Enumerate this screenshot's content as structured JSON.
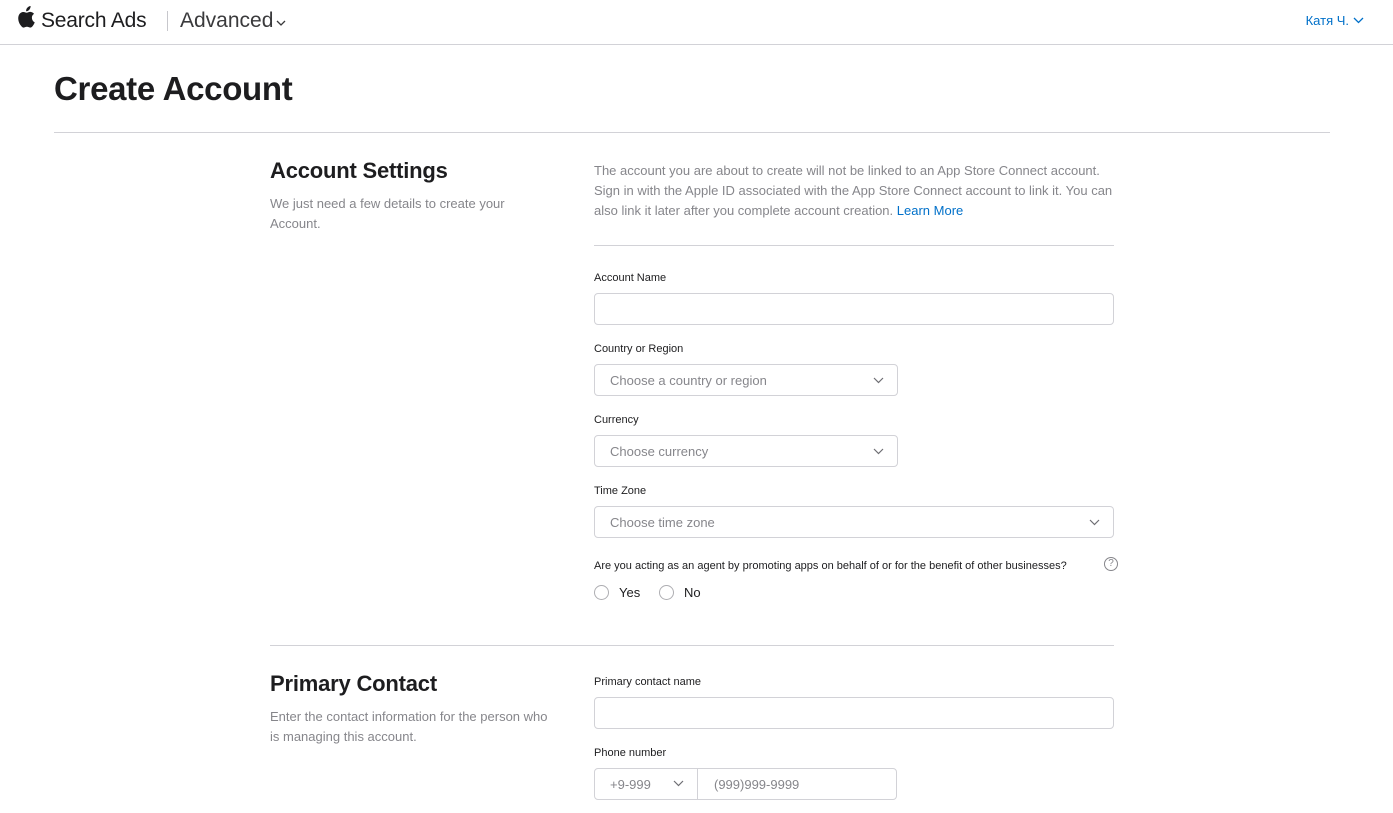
{
  "header": {
    "brand": "Search Ads",
    "mode": "Advanced",
    "user": "Катя Ч."
  },
  "page": {
    "title": "Create Account"
  },
  "account_settings": {
    "title": "Account Settings",
    "description": "We just need a few details to create your Account.",
    "intro_text": "The account you are about to create will not be linked to an App Store Connect account. Sign in with the Apple ID associated with the App Store Connect account to link it. You can also link it later after you complete account creation.",
    "learn_more": "Learn More",
    "account_name_label": "Account Name",
    "account_name_value": "",
    "country_label": "Country or Region",
    "country_placeholder": "Choose a country or region",
    "currency_label": "Currency",
    "currency_placeholder": "Choose currency",
    "timezone_label": "Time Zone",
    "timezone_placeholder": "Choose time zone",
    "agent_question": "Are you acting as an agent by promoting apps on behalf of or for the benefit of other businesses?",
    "help_glyph": "?",
    "yes_label": "Yes",
    "no_label": "No"
  },
  "primary_contact": {
    "title": "Primary Contact",
    "description": "Enter the contact information for the person who is managing this account.",
    "name_label": "Primary contact name",
    "name_value": "",
    "phone_label": "Phone number",
    "phone_code_placeholder": "+9-999",
    "phone_placeholder": "(999)999-9999"
  },
  "colors": {
    "link": "#0070c9",
    "text": "#1d1d1f",
    "secondary": "#86868b",
    "border": "#d2d2d7"
  },
  "icons": {
    "logo": "apple-logo-icon",
    "mode_dropdown": "chevron-down-icon",
    "user_dropdown": "chevron-down-icon",
    "select": "chevron-down-icon",
    "help": "question-circle-icon"
  }
}
